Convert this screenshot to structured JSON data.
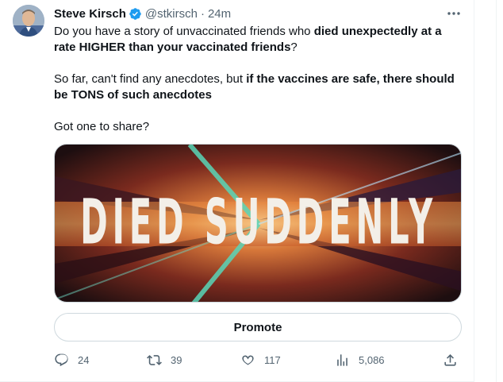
{
  "tweet": {
    "author_name": "Steve Kirsch",
    "handle": "@stkirsch",
    "separator": "·",
    "time": "24m",
    "paragraph1": {
      "t1": "Do you have a story of unvaccinated friends who ",
      "b1": "died unexpectedly at a rate HIGHER than your vaccinated friends",
      "t2": "?"
    },
    "paragraph2": {
      "t1": "So far, can't find any anecdotes, but ",
      "b1": "if the vaccines are safe, there should be TONS of such anecdotes"
    },
    "paragraph3": "Got one to share?",
    "media_text": "DIED SUDDENLY",
    "promote_label": "Promote"
  },
  "actions": {
    "replies": "24",
    "retweets": "39",
    "likes": "117",
    "views": "5,086"
  },
  "icons": {
    "verified": "verified-badge-icon",
    "more": "more-icon",
    "reply": "reply-icon",
    "retweet": "retweet-icon",
    "like": "heart-icon",
    "views": "views-icon",
    "share": "share-icon"
  },
  "colors": {
    "verified_blue": "#1d9bf0",
    "text": "#0f1419",
    "secondary": "#536471",
    "border": "#cfd9de"
  }
}
